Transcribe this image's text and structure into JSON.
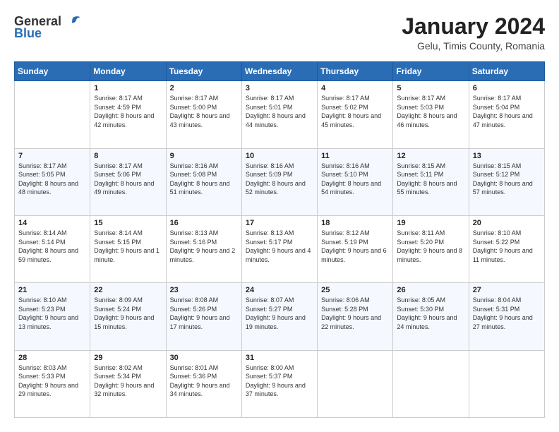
{
  "logo": {
    "general": "General",
    "blue": "Blue"
  },
  "title": "January 2024",
  "subtitle": "Gelu, Timis County, Romania",
  "days_of_week": [
    "Sunday",
    "Monday",
    "Tuesday",
    "Wednesday",
    "Thursday",
    "Friday",
    "Saturday"
  ],
  "weeks": [
    [
      {
        "day": "",
        "sunrise": "",
        "sunset": "",
        "daylight": ""
      },
      {
        "day": "1",
        "sunrise": "Sunrise: 8:17 AM",
        "sunset": "Sunset: 4:59 PM",
        "daylight": "Daylight: 8 hours and 42 minutes."
      },
      {
        "day": "2",
        "sunrise": "Sunrise: 8:17 AM",
        "sunset": "Sunset: 5:00 PM",
        "daylight": "Daylight: 8 hours and 43 minutes."
      },
      {
        "day": "3",
        "sunrise": "Sunrise: 8:17 AM",
        "sunset": "Sunset: 5:01 PM",
        "daylight": "Daylight: 8 hours and 44 minutes."
      },
      {
        "day": "4",
        "sunrise": "Sunrise: 8:17 AM",
        "sunset": "Sunset: 5:02 PM",
        "daylight": "Daylight: 8 hours and 45 minutes."
      },
      {
        "day": "5",
        "sunrise": "Sunrise: 8:17 AM",
        "sunset": "Sunset: 5:03 PM",
        "daylight": "Daylight: 8 hours and 46 minutes."
      },
      {
        "day": "6",
        "sunrise": "Sunrise: 8:17 AM",
        "sunset": "Sunset: 5:04 PM",
        "daylight": "Daylight: 8 hours and 47 minutes."
      }
    ],
    [
      {
        "day": "7",
        "sunrise": "Sunrise: 8:17 AM",
        "sunset": "Sunset: 5:05 PM",
        "daylight": "Daylight: 8 hours and 48 minutes."
      },
      {
        "day": "8",
        "sunrise": "Sunrise: 8:17 AM",
        "sunset": "Sunset: 5:06 PM",
        "daylight": "Daylight: 8 hours and 49 minutes."
      },
      {
        "day": "9",
        "sunrise": "Sunrise: 8:16 AM",
        "sunset": "Sunset: 5:08 PM",
        "daylight": "Daylight: 8 hours and 51 minutes."
      },
      {
        "day": "10",
        "sunrise": "Sunrise: 8:16 AM",
        "sunset": "Sunset: 5:09 PM",
        "daylight": "Daylight: 8 hours and 52 minutes."
      },
      {
        "day": "11",
        "sunrise": "Sunrise: 8:16 AM",
        "sunset": "Sunset: 5:10 PM",
        "daylight": "Daylight: 8 hours and 54 minutes."
      },
      {
        "day": "12",
        "sunrise": "Sunrise: 8:15 AM",
        "sunset": "Sunset: 5:11 PM",
        "daylight": "Daylight: 8 hours and 55 minutes."
      },
      {
        "day": "13",
        "sunrise": "Sunrise: 8:15 AM",
        "sunset": "Sunset: 5:12 PM",
        "daylight": "Daylight: 8 hours and 57 minutes."
      }
    ],
    [
      {
        "day": "14",
        "sunrise": "Sunrise: 8:14 AM",
        "sunset": "Sunset: 5:14 PM",
        "daylight": "Daylight: 8 hours and 59 minutes."
      },
      {
        "day": "15",
        "sunrise": "Sunrise: 8:14 AM",
        "sunset": "Sunset: 5:15 PM",
        "daylight": "Daylight: 9 hours and 1 minute."
      },
      {
        "day": "16",
        "sunrise": "Sunrise: 8:13 AM",
        "sunset": "Sunset: 5:16 PM",
        "daylight": "Daylight: 9 hours and 2 minutes."
      },
      {
        "day": "17",
        "sunrise": "Sunrise: 8:13 AM",
        "sunset": "Sunset: 5:17 PM",
        "daylight": "Daylight: 9 hours and 4 minutes."
      },
      {
        "day": "18",
        "sunrise": "Sunrise: 8:12 AM",
        "sunset": "Sunset: 5:19 PM",
        "daylight": "Daylight: 9 hours and 6 minutes."
      },
      {
        "day": "19",
        "sunrise": "Sunrise: 8:11 AM",
        "sunset": "Sunset: 5:20 PM",
        "daylight": "Daylight: 9 hours and 8 minutes."
      },
      {
        "day": "20",
        "sunrise": "Sunrise: 8:10 AM",
        "sunset": "Sunset: 5:22 PM",
        "daylight": "Daylight: 9 hours and 11 minutes."
      }
    ],
    [
      {
        "day": "21",
        "sunrise": "Sunrise: 8:10 AM",
        "sunset": "Sunset: 5:23 PM",
        "daylight": "Daylight: 9 hours and 13 minutes."
      },
      {
        "day": "22",
        "sunrise": "Sunrise: 8:09 AM",
        "sunset": "Sunset: 5:24 PM",
        "daylight": "Daylight: 9 hours and 15 minutes."
      },
      {
        "day": "23",
        "sunrise": "Sunrise: 8:08 AM",
        "sunset": "Sunset: 5:26 PM",
        "daylight": "Daylight: 9 hours and 17 minutes."
      },
      {
        "day": "24",
        "sunrise": "Sunrise: 8:07 AM",
        "sunset": "Sunset: 5:27 PM",
        "daylight": "Daylight: 9 hours and 19 minutes."
      },
      {
        "day": "25",
        "sunrise": "Sunrise: 8:06 AM",
        "sunset": "Sunset: 5:28 PM",
        "daylight": "Daylight: 9 hours and 22 minutes."
      },
      {
        "day": "26",
        "sunrise": "Sunrise: 8:05 AM",
        "sunset": "Sunset: 5:30 PM",
        "daylight": "Daylight: 9 hours and 24 minutes."
      },
      {
        "day": "27",
        "sunrise": "Sunrise: 8:04 AM",
        "sunset": "Sunset: 5:31 PM",
        "daylight": "Daylight: 9 hours and 27 minutes."
      }
    ],
    [
      {
        "day": "28",
        "sunrise": "Sunrise: 8:03 AM",
        "sunset": "Sunset: 5:33 PM",
        "daylight": "Daylight: 9 hours and 29 minutes."
      },
      {
        "day": "29",
        "sunrise": "Sunrise: 8:02 AM",
        "sunset": "Sunset: 5:34 PM",
        "daylight": "Daylight: 9 hours and 32 minutes."
      },
      {
        "day": "30",
        "sunrise": "Sunrise: 8:01 AM",
        "sunset": "Sunset: 5:36 PM",
        "daylight": "Daylight: 9 hours and 34 minutes."
      },
      {
        "day": "31",
        "sunrise": "Sunrise: 8:00 AM",
        "sunset": "Sunset: 5:37 PM",
        "daylight": "Daylight: 9 hours and 37 minutes."
      },
      {
        "day": "",
        "sunrise": "",
        "sunset": "",
        "daylight": ""
      },
      {
        "day": "",
        "sunrise": "",
        "sunset": "",
        "daylight": ""
      },
      {
        "day": "",
        "sunrise": "",
        "sunset": "",
        "daylight": ""
      }
    ]
  ]
}
